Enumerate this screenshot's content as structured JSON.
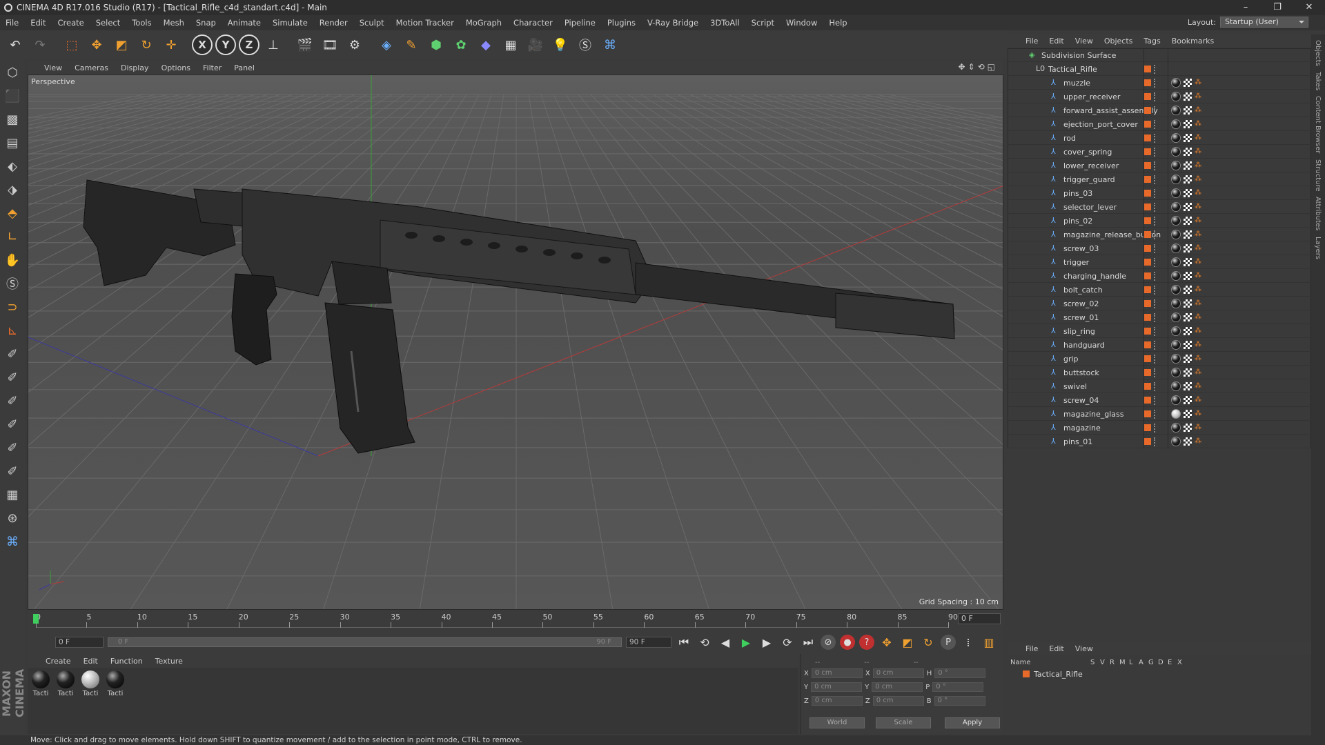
{
  "window": {
    "title": "CINEMA 4D R17.016 Studio (R17) - [Tactical_Rifle_c4d_standart.c4d] - Main",
    "min": "–",
    "max": "❐",
    "close": "✕"
  },
  "menu": [
    "File",
    "Edit",
    "Create",
    "Select",
    "Tools",
    "Mesh",
    "Snap",
    "Animate",
    "Simulate",
    "Render",
    "Sculpt",
    "Motion Tracker",
    "MoGraph",
    "Character",
    "Pipeline",
    "Plugins",
    "V-Ray Bridge",
    "3DToAll",
    "Script",
    "Window",
    "Help"
  ],
  "layout": {
    "label": "Layout:",
    "value": "Startup (User)"
  },
  "viewport": {
    "menu": [
      "View",
      "Cameras",
      "Display",
      "Options",
      "Filter",
      "Panel"
    ],
    "camera_label": "Perspective",
    "grid_spacing": "Grid Spacing : 10 cm"
  },
  "timeline": {
    "ticks": [
      "0",
      "5",
      "10",
      "15",
      "20",
      "25",
      "30",
      "35",
      "40",
      "45",
      "50",
      "55",
      "60",
      "65",
      "70",
      "75",
      "80",
      "85",
      "90"
    ],
    "current_frame": "0 F"
  },
  "transport": {
    "start": "0 F",
    "range_start": "0 F",
    "range_end": "90 F",
    "end": "90 F"
  },
  "materials": {
    "menu": [
      "Create",
      "Edit",
      "Function",
      "Texture"
    ],
    "items": [
      {
        "name": "Tacti",
        "style": "dark"
      },
      {
        "name": "Tacti",
        "style": "dark"
      },
      {
        "name": "Tacti",
        "style": "light"
      },
      {
        "name": "Tacti",
        "style": "dark"
      }
    ]
  },
  "coordinates": {
    "header": [
      "--",
      "--",
      "--"
    ],
    "rows": [
      {
        "a": "X",
        "av": "0 cm",
        "b": "X",
        "bv": "0 cm",
        "c": "H",
        "cv": "0 °"
      },
      {
        "a": "Y",
        "av": "0 cm",
        "b": "Y",
        "bv": "0 cm",
        "c": "P",
        "cv": "0 °"
      },
      {
        "a": "Z",
        "av": "0 cm",
        "b": "Z",
        "bv": "0 cm",
        "c": "B",
        "cv": "0 °"
      }
    ],
    "mode": "World",
    "scale": "Scale",
    "apply": "Apply"
  },
  "objects": {
    "menu": [
      "File",
      "Edit",
      "View",
      "Objects",
      "Tags",
      "Bookmarks"
    ],
    "root": "Subdivision Surface",
    "group": "Tactical_Rifle",
    "items": [
      "muzzle",
      "upper_receiver",
      "forward_assist_assembly",
      "ejection_port_cover",
      "rod",
      "cover_spring",
      "lower_receiver",
      "trigger_guard",
      "pins_03",
      "selector_lever",
      "pins_02",
      "magazine_release_button",
      "screw_03",
      "trigger",
      "charging_handle",
      "bolt_catch",
      "screw_02",
      "screw_01",
      "slip_ring",
      "handguard",
      "grip",
      "buttstock",
      "swivel",
      "screw_04",
      "magazine_glass",
      "magazine",
      "pins_01"
    ],
    "light_material_item": "magazine_glass"
  },
  "layers": {
    "menu": [
      "File",
      "Edit",
      "View"
    ],
    "columns": [
      "Name",
      "S",
      "V",
      "R",
      "M",
      "L",
      "A",
      "G",
      "D",
      "E",
      "X"
    ],
    "row": "Tactical_Rifle"
  },
  "right_tabs": [
    "Objects",
    "Takes",
    "Content Browser",
    "Structure",
    "Attributes",
    "Layers"
  ],
  "status": "Move: Click and drag to move elements. Hold down SHIFT to quantize movement / add to the selection in point mode, CTRL to remove.",
  "brand": "MAXON CINEMA 4D",
  "colors": {
    "accent_orange": "#e86a2a",
    "playhead_green": "#3fcf5f",
    "joint_blue": "#6ab0ff"
  }
}
